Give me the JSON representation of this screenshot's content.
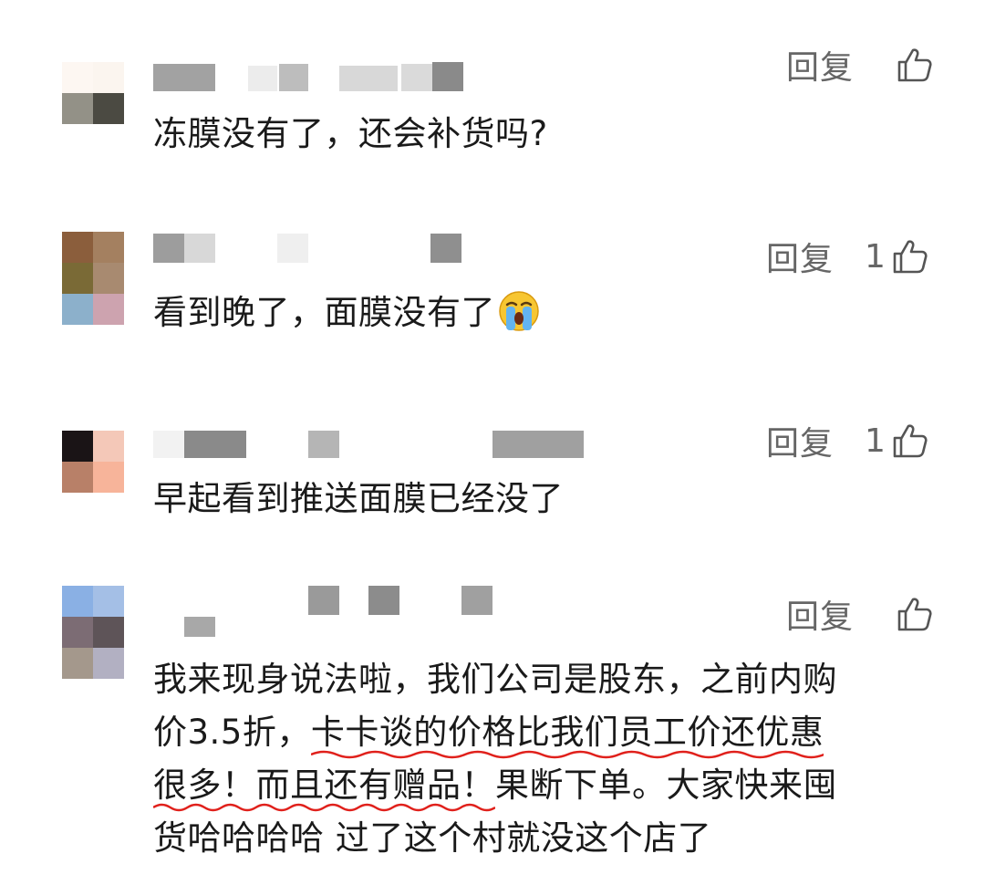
{
  "comments": [
    {
      "text": "冻膜没有了，还会补货吗?",
      "reply_label": "回复",
      "likes": ""
    },
    {
      "text": "看到晚了，面膜没有了",
      "reply_label": "回复",
      "likes": "1",
      "emoji": "crying-face-emoji"
    },
    {
      "text": "早起看到推送面膜已经没了",
      "reply_label": "回复",
      "likes": "1"
    },
    {
      "reply_label": "回复",
      "likes": "",
      "lines": [
        {
          "plain": "我来现身说法啦，我们公司是股东，之前内购"
        },
        {
          "plain": "价3.5折，",
          "highlight": "卡卡谈的价格比我们员工价还优惠"
        },
        {
          "highlight": "很多！而且还有赠品！",
          "plain": "果断下单。大家快来囤"
        },
        {
          "plain": "货哈哈哈哈 过了这个村就没这个店了"
        }
      ]
    }
  ],
  "icons": {
    "like": "thumbs-up-icon",
    "emoji": "crying-face-emoji"
  },
  "colors": {
    "highlight_underline": "#e0201b",
    "action_text": "#666666",
    "body_text": "#1a1a1a"
  }
}
